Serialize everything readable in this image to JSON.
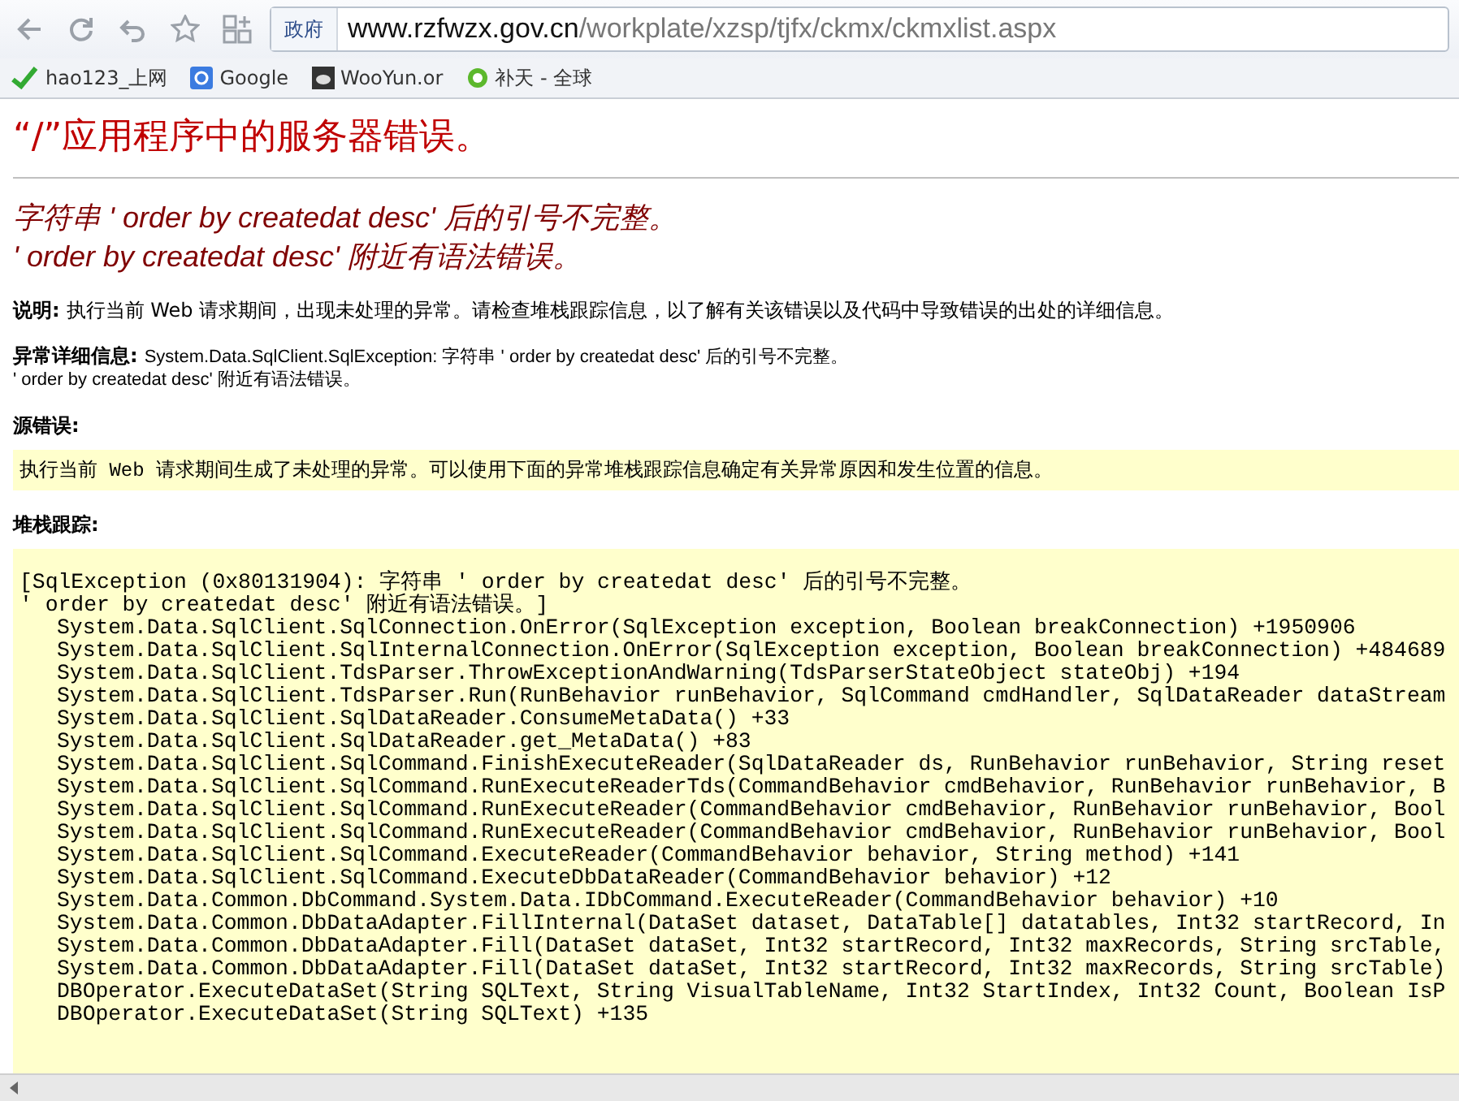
{
  "browser": {
    "address_prefix": "政府",
    "address_host": "www.rzfwzx.gov.cn",
    "address_path": "/workplate/xzsp/tjfx/ckmx/ckmxlist.aspx",
    "bookmarks": [
      {
        "label": "hao123_上网",
        "kind": "hao"
      },
      {
        "label": "Google",
        "kind": "google"
      },
      {
        "label": "WooYun.or",
        "kind": "wooyun"
      },
      {
        "label": "补天 - 全球",
        "kind": "ie"
      }
    ]
  },
  "page": {
    "title": "“/”应用程序中的服务器错误。",
    "subtitle_lines": [
      "字符串 ' order by createdat desc' 后的引号不完整。",
      "' order by createdat desc' 附近有语法错误。"
    ],
    "description": {
      "label": "说明:",
      "text": "执行当前 Web 请求期间，出现未处理的异常。请检查堆栈跟踪信息，以了解有关该错误以及代码中导致错误的出处的详细信息。"
    },
    "exception_details": {
      "label": "异常详细信息:",
      "lines": [
        "System.Data.SqlClient.SqlException: 字符串 ' order by createdat desc' 后的引号不完整。",
        "' order by createdat desc' 附近有语法错误。"
      ]
    },
    "source_error": {
      "label": "源错误:",
      "text": "执行当前 Web 请求期间生成了未处理的异常。可以使用下面的异常堆栈跟踪信息确定有关异常原因和发生位置的信息。"
    },
    "stack_trace": {
      "label": "堆栈跟踪:",
      "header_lines": [
        "[SqlException (0x80131904): 字符串 ' order by createdat desc' 后的引号不完整。",
        "' order by createdat desc' 附近有语法错误。]"
      ],
      "frames": [
        "System.Data.SqlClient.SqlConnection.OnError(SqlException exception, Boolean breakConnection) +1950906",
        "System.Data.SqlClient.SqlInternalConnection.OnError(SqlException exception, Boolean breakConnection) +484689",
        "System.Data.SqlClient.TdsParser.ThrowExceptionAndWarning(TdsParserStateObject stateObj) +194",
        "System.Data.SqlClient.TdsParser.Run(RunBehavior runBehavior, SqlCommand cmdHandler, SqlDataReader dataStream",
        "System.Data.SqlClient.SqlDataReader.ConsumeMetaData() +33",
        "System.Data.SqlClient.SqlDataReader.get_MetaData() +83",
        "System.Data.SqlClient.SqlCommand.FinishExecuteReader(SqlDataReader ds, RunBehavior runBehavior, String reset",
        "System.Data.SqlClient.SqlCommand.RunExecuteReaderTds(CommandBehavior cmdBehavior, RunBehavior runBehavior, B",
        "System.Data.SqlClient.SqlCommand.RunExecuteReader(CommandBehavior cmdBehavior, RunBehavior runBehavior, Bool",
        "System.Data.SqlClient.SqlCommand.RunExecuteReader(CommandBehavior cmdBehavior, RunBehavior runBehavior, Bool",
        "System.Data.SqlClient.SqlCommand.ExecuteReader(CommandBehavior behavior, String method) +141",
        "System.Data.SqlClient.SqlCommand.ExecuteDbDataReader(CommandBehavior behavior) +12",
        "System.Data.Common.DbCommand.System.Data.IDbCommand.ExecuteReader(CommandBehavior behavior) +10",
        "System.Data.Common.DbDataAdapter.FillInternal(DataSet dataset, DataTable[] datatables, Int32 startRecord, In",
        "System.Data.Common.DbDataAdapter.Fill(DataSet dataSet, Int32 startRecord, Int32 maxRecords, String srcTable,",
        "System.Data.Common.DbDataAdapter.Fill(DataSet dataSet, Int32 startRecord, Int32 maxRecords, String srcTable)",
        "DBOperator.ExecuteDataSet(String SQLText, String VisualTableName, Int32 StartIndex, Int32 Count, Boolean IsP",
        "DBOperator.ExecuteDataSet(String SQLText) +135"
      ]
    }
  }
}
